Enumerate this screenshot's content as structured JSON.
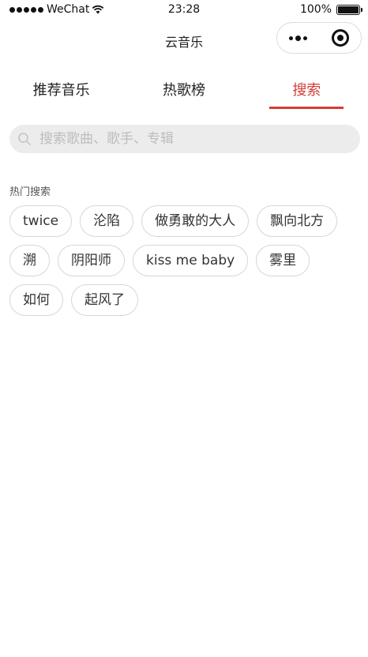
{
  "status_bar": {
    "carrier": "WeChat",
    "time": "23:28",
    "battery_percent": "100%",
    "battery_level": 1.0
  },
  "nav": {
    "title": "云音乐"
  },
  "tabs": [
    {
      "label": "推荐音乐",
      "active": false
    },
    {
      "label": "热歌榜",
      "active": false
    },
    {
      "label": "搜索",
      "active": true
    }
  ],
  "search": {
    "placeholder": "搜索歌曲、歌手、专辑",
    "value": ""
  },
  "hot_search": {
    "title": "热门搜索",
    "tags": [
      "twice",
      "沦陷",
      "做勇敢的大人",
      "飘向北方",
      "溯",
      "阴阳师",
      "kiss me baby",
      "雾里",
      "如何",
      "起风了"
    ]
  },
  "colors": {
    "accent": "#d43c33",
    "search_bg": "#ececec",
    "tag_border": "#d6d6d6"
  }
}
